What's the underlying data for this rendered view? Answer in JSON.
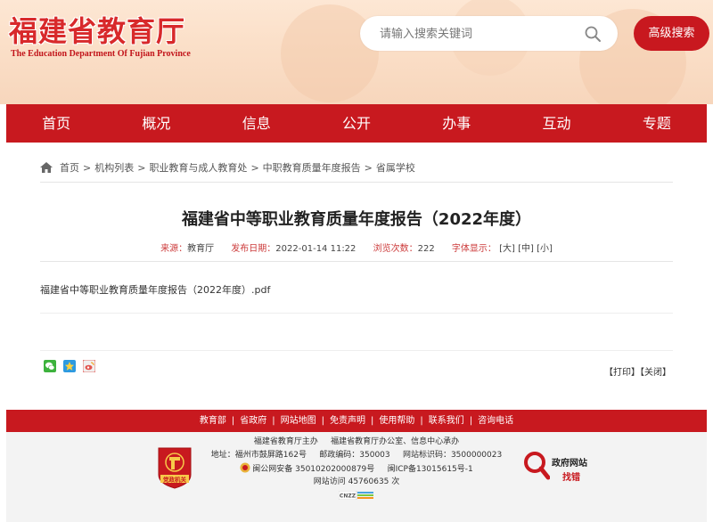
{
  "header": {
    "logo_cn": "福建省教育厅",
    "logo_en": "The Education Department Of Fujian Province",
    "search_placeholder": "请输入搜索关键词",
    "advanced_search": "高级搜索"
  },
  "nav": [
    "首页",
    "概况",
    "信息",
    "公开",
    "办事",
    "互动",
    "专题"
  ],
  "breadcrumb": [
    "首页",
    "机构列表",
    "职业教育与成人教育处",
    "中职教育质量年度报告",
    "省属学校"
  ],
  "article": {
    "title": "福建省中等职业教育质量年度报告（2022年度）",
    "source_label": "来源：",
    "source": "教育厅",
    "date_label": "发布日期：",
    "date": "2022-01-14 11:22",
    "views_label": "浏览次数：",
    "views": "222",
    "font_label": "字体显示：",
    "font_large": "[大]",
    "font_medium": "[中]",
    "font_small": "[小]",
    "attachment": "福建省中等职业教育质量年度报告（2022年度）.pdf",
    "print": "【打印】",
    "close": "【关闭】"
  },
  "footer": {
    "links": [
      "教育部",
      "省政府",
      "网站地图",
      "免责声明",
      "使用帮助",
      "联系我们",
      "咨询电话"
    ],
    "sponsor": "福建省教育厅主办",
    "organizer": "福建省教育厅办公室、信息中心承办",
    "address": "地址：福州市鼓屏路162号",
    "postcode": "邮政编码：350003",
    "site_code": "网站标识码：3500000023",
    "police": "闽公网安备 35010202000879号",
    "icp": "闽ICP备13015615号-1",
    "visits": "网站访问 45760635 次",
    "cnzz": "CNZZ",
    "badge_text": "党政机关",
    "zhaocuo_title": "政府网站",
    "zhaocuo_sub": "找错"
  },
  "colors": {
    "brand_red": "#c8191f",
    "header_bg": "#fbe0c9",
    "meta_label": "#cc3b3b"
  },
  "icons": [
    "search-icon",
    "home-icon",
    "wechat-icon",
    "qzone-icon",
    "weibo-icon",
    "police-icon",
    "party-badge-icon",
    "zhaocuo-icon"
  ]
}
